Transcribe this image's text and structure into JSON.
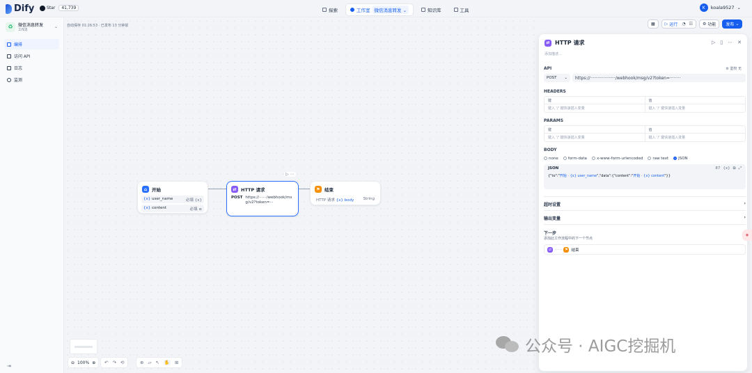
{
  "brand": {
    "name": "Dify"
  },
  "github": {
    "label": "Star",
    "count": "41,739"
  },
  "nav": [
    {
      "label": "探索"
    },
    {
      "label": "工作室",
      "sub": "微信消息转发"
    },
    {
      "label": "知识库"
    },
    {
      "label": "工具"
    }
  ],
  "user": {
    "initial": "K",
    "name": "koala9527"
  },
  "app": {
    "name": "微信消息转发",
    "type": "工作流"
  },
  "sidebar": {
    "items": [
      {
        "label": "编排"
      },
      {
        "label": "访问 API"
      },
      {
        "label": "日志"
      },
      {
        "label": "监测"
      }
    ]
  },
  "canvas": {
    "autosave": "自动保存 01:26:53 · 已发布 13 分钟前",
    "toolbar": {
      "run": "运行",
      "features": "功能",
      "publish": "发布"
    },
    "zoom": "100%"
  },
  "nodes": {
    "start": {
      "title": "开始",
      "vars": [
        {
          "name": "user_name",
          "req": "必填",
          "type": "{x}"
        },
        {
          "name": "content",
          "req": "必填",
          "type": "≡"
        }
      ]
    },
    "http": {
      "title": "HTTP 请求",
      "method": "POST",
      "url": "https://······/webhook/msg/v2?token=···"
    },
    "end": {
      "title": "结束",
      "src": "HTTP 请求",
      "var": "body",
      "type": "String"
    }
  },
  "panel": {
    "title": "HTTP 请求",
    "desc": "添加描述...",
    "api_label": "API",
    "auth": "鉴权 无",
    "method": "POST",
    "url": "https://···················/webhook/msg/v2?token=········",
    "headers_label": "HEADERS",
    "params_label": "PARAMS",
    "kv": {
      "key": "键",
      "value": "值",
      "key_ph": "键入 '/' 键快速插入变量",
      "val_ph": "键入 '/' 键快速插入变量"
    },
    "body_label": "BODY",
    "body_opts": [
      "none",
      "form-data",
      "x-www-form-urlencoded",
      "raw text",
      "JSON"
    ],
    "body_selected": "JSON",
    "json": {
      "label": "JSON",
      "len": "87",
      "p1": "{\"to\":\"",
      "t1": "开始 · {x} user_name",
      "p2": "\",\"data\":{\"content\":\"",
      "t2": "开始 · {x} content",
      "p3": "\"}}"
    },
    "timeout": "超时设置",
    "output": "输出变量",
    "next_title": "下一步",
    "next_desc": "添加此工作流程中的下一个节点",
    "next_node": "结束"
  },
  "watermark": {
    "text": "公众号 · AIGC挖掘机"
  },
  "colors": {
    "accent": "#155eef",
    "start": "#2970ff",
    "http": "#875bf7",
    "end": "#f79009"
  }
}
